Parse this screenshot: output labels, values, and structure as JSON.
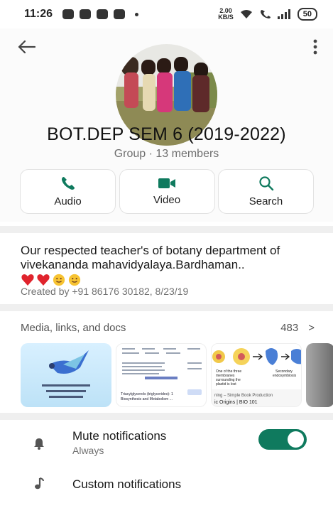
{
  "status_bar": {
    "time": "11:26",
    "net_speed": "2.00",
    "net_unit": "KB/S",
    "battery": "50"
  },
  "group": {
    "name": "BOT.DEP SEM 6 (2019-2022)",
    "subtitle": "Group · 13 members"
  },
  "actions": [
    {
      "label": "Audio",
      "icon": "phone-icon"
    },
    {
      "label": "Video",
      "icon": "video-icon"
    },
    {
      "label": "Search",
      "icon": "search-icon"
    }
  ],
  "description": {
    "text": "Our respected teacher's of botany department of vivekananda mahavidyalaya.Bardhaman..",
    "created": "Created by +91 86176 30182, 8/23/19"
  },
  "media": {
    "header": "Media, links, and docs",
    "count": "483",
    "chevron": ">"
  },
  "thumbs": {
    "b_caption1": "Triacylglycerols (triglycerides): 1",
    "b_caption2": "Biosynthesis and Metabolism ...",
    "c_caption1": "One of the three",
    "c_caption2": "membranes",
    "c_caption3": "surrounding the",
    "c_caption4": "plastid is lost",
    "c_secondary": "Secondary",
    "c_endo": "endosymbiosis",
    "c_footer1": "ning – Simple Book Production",
    "c_footer2": "ic Origins | BIO 101"
  },
  "settings": {
    "mute": {
      "title": "Mute notifications",
      "sub": "Always",
      "enabled": true
    },
    "custom": {
      "title": "Custom notifications"
    }
  },
  "colors": {
    "accent": "#0f7a5e",
    "toggle_on": "#0f7a5e"
  }
}
